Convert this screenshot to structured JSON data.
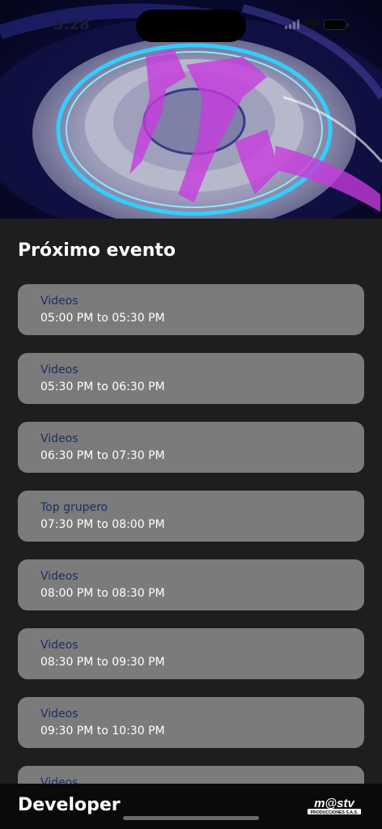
{
  "status_bar": {
    "time": "5:28",
    "icons": [
      "signal-icon",
      "wifi-icon",
      "battery-icon"
    ]
  },
  "hero": {
    "image": "live-stream-thumbnail"
  },
  "section_title": "Próximo evento",
  "events": [
    {
      "name": "Videos",
      "time": "05:00 PM to 05:30 PM"
    },
    {
      "name": "Videos",
      "time": "05:30 PM to 06:30 PM"
    },
    {
      "name": "Videos",
      "time": "06:30 PM to 07:30 PM"
    },
    {
      "name": "Top grupero",
      "time": "07:30 PM to 08:00 PM"
    },
    {
      "name": "Videos",
      "time": "08:00 PM to 08:30 PM"
    },
    {
      "name": "Videos",
      "time": "08:30 PM to 09:30 PM"
    },
    {
      "name": "Videos",
      "time": "09:30 PM to 10:30 PM"
    },
    {
      "name": "Videos",
      "time": ""
    }
  ],
  "bottom_bar": {
    "label": "Developer",
    "logo_text": "m@stv",
    "logo_subtext": "PRODUCCIONES S.A.S."
  },
  "colors": {
    "background": "#1e1e1e",
    "card": "#7b7b7b",
    "event_name": "#1d2f63",
    "bottom_bar": "#0a0a0a"
  }
}
